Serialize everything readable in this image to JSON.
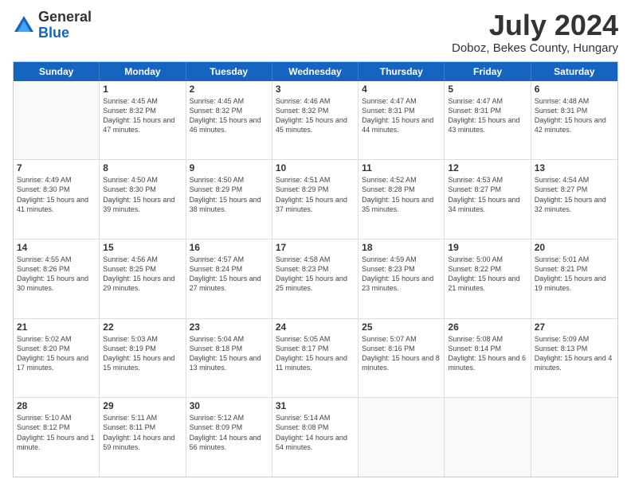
{
  "logo": {
    "general": "General",
    "blue": "Blue"
  },
  "title": "July 2024",
  "location": "Doboz, Bekes County, Hungary",
  "header_days": [
    "Sunday",
    "Monday",
    "Tuesday",
    "Wednesday",
    "Thursday",
    "Friday",
    "Saturday"
  ],
  "weeks": [
    [
      {
        "day": "",
        "sunrise": "",
        "sunset": "",
        "daylight": ""
      },
      {
        "day": "1",
        "sunrise": "Sunrise: 4:45 AM",
        "sunset": "Sunset: 8:32 PM",
        "daylight": "Daylight: 15 hours and 47 minutes."
      },
      {
        "day": "2",
        "sunrise": "Sunrise: 4:45 AM",
        "sunset": "Sunset: 8:32 PM",
        "daylight": "Daylight: 15 hours and 46 minutes."
      },
      {
        "day": "3",
        "sunrise": "Sunrise: 4:46 AM",
        "sunset": "Sunset: 8:32 PM",
        "daylight": "Daylight: 15 hours and 45 minutes."
      },
      {
        "day": "4",
        "sunrise": "Sunrise: 4:47 AM",
        "sunset": "Sunset: 8:31 PM",
        "daylight": "Daylight: 15 hours and 44 minutes."
      },
      {
        "day": "5",
        "sunrise": "Sunrise: 4:47 AM",
        "sunset": "Sunset: 8:31 PM",
        "daylight": "Daylight: 15 hours and 43 minutes."
      },
      {
        "day": "6",
        "sunrise": "Sunrise: 4:48 AM",
        "sunset": "Sunset: 8:31 PM",
        "daylight": "Daylight: 15 hours and 42 minutes."
      }
    ],
    [
      {
        "day": "7",
        "sunrise": "Sunrise: 4:49 AM",
        "sunset": "Sunset: 8:30 PM",
        "daylight": "Daylight: 15 hours and 41 minutes."
      },
      {
        "day": "8",
        "sunrise": "Sunrise: 4:50 AM",
        "sunset": "Sunset: 8:30 PM",
        "daylight": "Daylight: 15 hours and 39 minutes."
      },
      {
        "day": "9",
        "sunrise": "Sunrise: 4:50 AM",
        "sunset": "Sunset: 8:29 PM",
        "daylight": "Daylight: 15 hours and 38 minutes."
      },
      {
        "day": "10",
        "sunrise": "Sunrise: 4:51 AM",
        "sunset": "Sunset: 8:29 PM",
        "daylight": "Daylight: 15 hours and 37 minutes."
      },
      {
        "day": "11",
        "sunrise": "Sunrise: 4:52 AM",
        "sunset": "Sunset: 8:28 PM",
        "daylight": "Daylight: 15 hours and 35 minutes."
      },
      {
        "day": "12",
        "sunrise": "Sunrise: 4:53 AM",
        "sunset": "Sunset: 8:27 PM",
        "daylight": "Daylight: 15 hours and 34 minutes."
      },
      {
        "day": "13",
        "sunrise": "Sunrise: 4:54 AM",
        "sunset": "Sunset: 8:27 PM",
        "daylight": "Daylight: 15 hours and 32 minutes."
      }
    ],
    [
      {
        "day": "14",
        "sunrise": "Sunrise: 4:55 AM",
        "sunset": "Sunset: 8:26 PM",
        "daylight": "Daylight: 15 hours and 30 minutes."
      },
      {
        "day": "15",
        "sunrise": "Sunrise: 4:56 AM",
        "sunset": "Sunset: 8:25 PM",
        "daylight": "Daylight: 15 hours and 29 minutes."
      },
      {
        "day": "16",
        "sunrise": "Sunrise: 4:57 AM",
        "sunset": "Sunset: 8:24 PM",
        "daylight": "Daylight: 15 hours and 27 minutes."
      },
      {
        "day": "17",
        "sunrise": "Sunrise: 4:58 AM",
        "sunset": "Sunset: 8:23 PM",
        "daylight": "Daylight: 15 hours and 25 minutes."
      },
      {
        "day": "18",
        "sunrise": "Sunrise: 4:59 AM",
        "sunset": "Sunset: 8:23 PM",
        "daylight": "Daylight: 15 hours and 23 minutes."
      },
      {
        "day": "19",
        "sunrise": "Sunrise: 5:00 AM",
        "sunset": "Sunset: 8:22 PM",
        "daylight": "Daylight: 15 hours and 21 minutes."
      },
      {
        "day": "20",
        "sunrise": "Sunrise: 5:01 AM",
        "sunset": "Sunset: 8:21 PM",
        "daylight": "Daylight: 15 hours and 19 minutes."
      }
    ],
    [
      {
        "day": "21",
        "sunrise": "Sunrise: 5:02 AM",
        "sunset": "Sunset: 8:20 PM",
        "daylight": "Daylight: 15 hours and 17 minutes."
      },
      {
        "day": "22",
        "sunrise": "Sunrise: 5:03 AM",
        "sunset": "Sunset: 8:19 PM",
        "daylight": "Daylight: 15 hours and 15 minutes."
      },
      {
        "day": "23",
        "sunrise": "Sunrise: 5:04 AM",
        "sunset": "Sunset: 8:18 PM",
        "daylight": "Daylight: 15 hours and 13 minutes."
      },
      {
        "day": "24",
        "sunrise": "Sunrise: 5:05 AM",
        "sunset": "Sunset: 8:17 PM",
        "daylight": "Daylight: 15 hours and 11 minutes."
      },
      {
        "day": "25",
        "sunrise": "Sunrise: 5:07 AM",
        "sunset": "Sunset: 8:16 PM",
        "daylight": "Daylight: 15 hours and 8 minutes."
      },
      {
        "day": "26",
        "sunrise": "Sunrise: 5:08 AM",
        "sunset": "Sunset: 8:14 PM",
        "daylight": "Daylight: 15 hours and 6 minutes."
      },
      {
        "day": "27",
        "sunrise": "Sunrise: 5:09 AM",
        "sunset": "Sunset: 8:13 PM",
        "daylight": "Daylight: 15 hours and 4 minutes."
      }
    ],
    [
      {
        "day": "28",
        "sunrise": "Sunrise: 5:10 AM",
        "sunset": "Sunset: 8:12 PM",
        "daylight": "Daylight: 15 hours and 1 minute."
      },
      {
        "day": "29",
        "sunrise": "Sunrise: 5:11 AM",
        "sunset": "Sunset: 8:11 PM",
        "daylight": "Daylight: 14 hours and 59 minutes."
      },
      {
        "day": "30",
        "sunrise": "Sunrise: 5:12 AM",
        "sunset": "Sunset: 8:09 PM",
        "daylight": "Daylight: 14 hours and 56 minutes."
      },
      {
        "day": "31",
        "sunrise": "Sunrise: 5:14 AM",
        "sunset": "Sunset: 8:08 PM",
        "daylight": "Daylight: 14 hours and 54 minutes."
      },
      {
        "day": "",
        "sunrise": "",
        "sunset": "",
        "daylight": ""
      },
      {
        "day": "",
        "sunrise": "",
        "sunset": "",
        "daylight": ""
      },
      {
        "day": "",
        "sunrise": "",
        "sunset": "",
        "daylight": ""
      }
    ]
  ]
}
